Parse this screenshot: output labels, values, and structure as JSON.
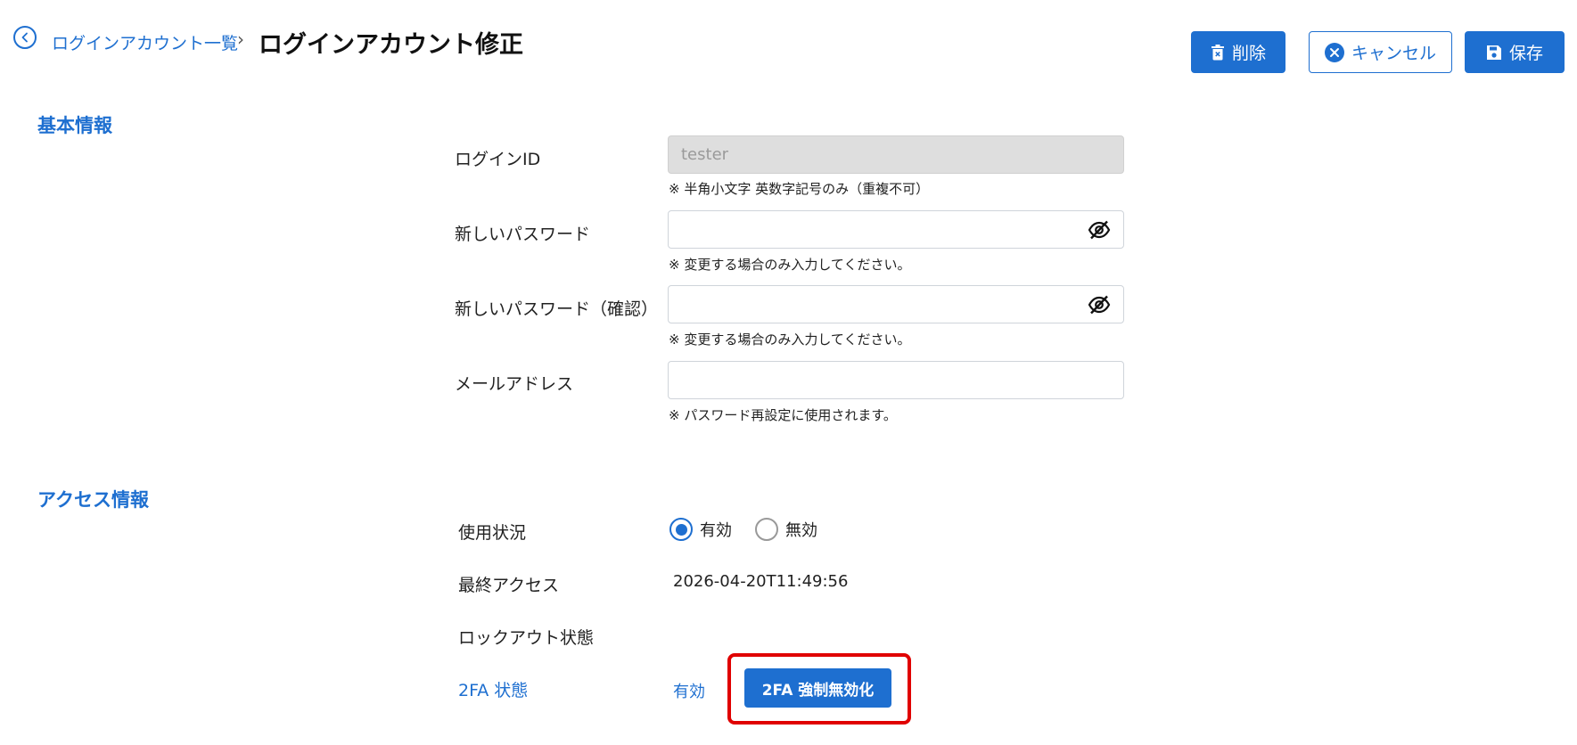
{
  "header": {
    "breadcrumb_link": "ログインアカウント一覧",
    "breadcrumb_separator": "›",
    "title": "ログインアカウント修正",
    "buttons": {
      "delete": "削除",
      "cancel": "キャンセル",
      "save": "保存"
    }
  },
  "basic_info": {
    "section_title": "基本情報",
    "login_id": {
      "label": "ログインID",
      "value": "tester",
      "hint": "※ 半角小文字 英数字記号のみ（重複不可）"
    },
    "new_password": {
      "label": "新しいパスワード",
      "value": "",
      "hint": "※ 変更する場合のみ入力してください。"
    },
    "new_password_confirm": {
      "label": "新しいパスワード（確認）",
      "value": "",
      "hint": "※ 変更する場合のみ入力してください。"
    },
    "email": {
      "label": "メールアドレス",
      "value": "",
      "hint": "※ パスワード再設定に使用されます。"
    }
  },
  "access_info": {
    "section_title": "アクセス情報",
    "usage_status": {
      "label": "使用状況",
      "options": [
        "有効",
        "無効"
      ],
      "selected": "有効"
    },
    "last_access": {
      "label": "最終アクセス",
      "value": "2026-04-20T11:49:56"
    },
    "lockout_status": {
      "label": "ロックアウト状態",
      "value": ""
    },
    "twofa_status": {
      "label": "2FA 状態",
      "value": "有効",
      "force_disable_button": "2FA 強制無効化"
    }
  },
  "colors": {
    "accent": "#1e6fd0",
    "highlight": "#e00000",
    "disabled_field": "#dedede"
  },
  "icons": {
    "back": "chevron-left-icon",
    "delete": "trash-icon",
    "cancel": "close-circle-icon",
    "save": "floppy-disk-icon",
    "password_toggle": "eye-off-icon"
  }
}
